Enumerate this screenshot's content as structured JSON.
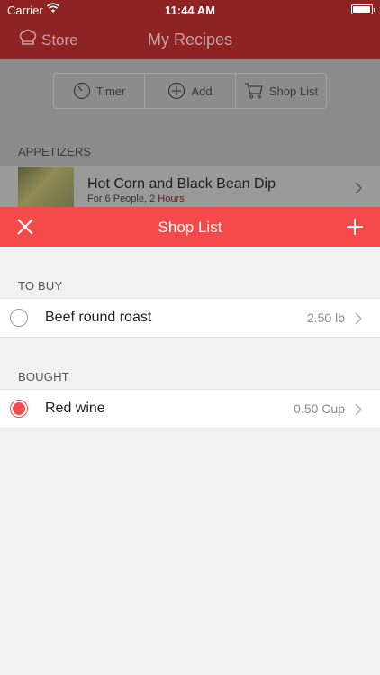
{
  "status_bar": {
    "carrier": "Carrier",
    "time": "11:44 AM"
  },
  "nav": {
    "store_label": "Store",
    "title": "My Recipes"
  },
  "toolbar": {
    "timer_label": "Timer",
    "add_label": "Add",
    "shoplist_label": "Shop List"
  },
  "recipes": {
    "section_title": "APPETIZERS",
    "items": [
      {
        "title": "Hot Corn and Black Bean Dip",
        "serves": "For 6 People,",
        "time": "2 Hours"
      }
    ]
  },
  "shop_list": {
    "title": "Shop List",
    "to_buy_label": "TO BUY",
    "bought_label": "BOUGHT",
    "to_buy": [
      {
        "name": "Beef round roast",
        "quantity": "2.50 lb",
        "checked": false
      }
    ],
    "bought": [
      {
        "name": "Red wine",
        "quantity": "0.50 Cup",
        "checked": true
      }
    ]
  },
  "colors": {
    "accent": "#f44a4a",
    "nav_dark": "#8e2323"
  }
}
